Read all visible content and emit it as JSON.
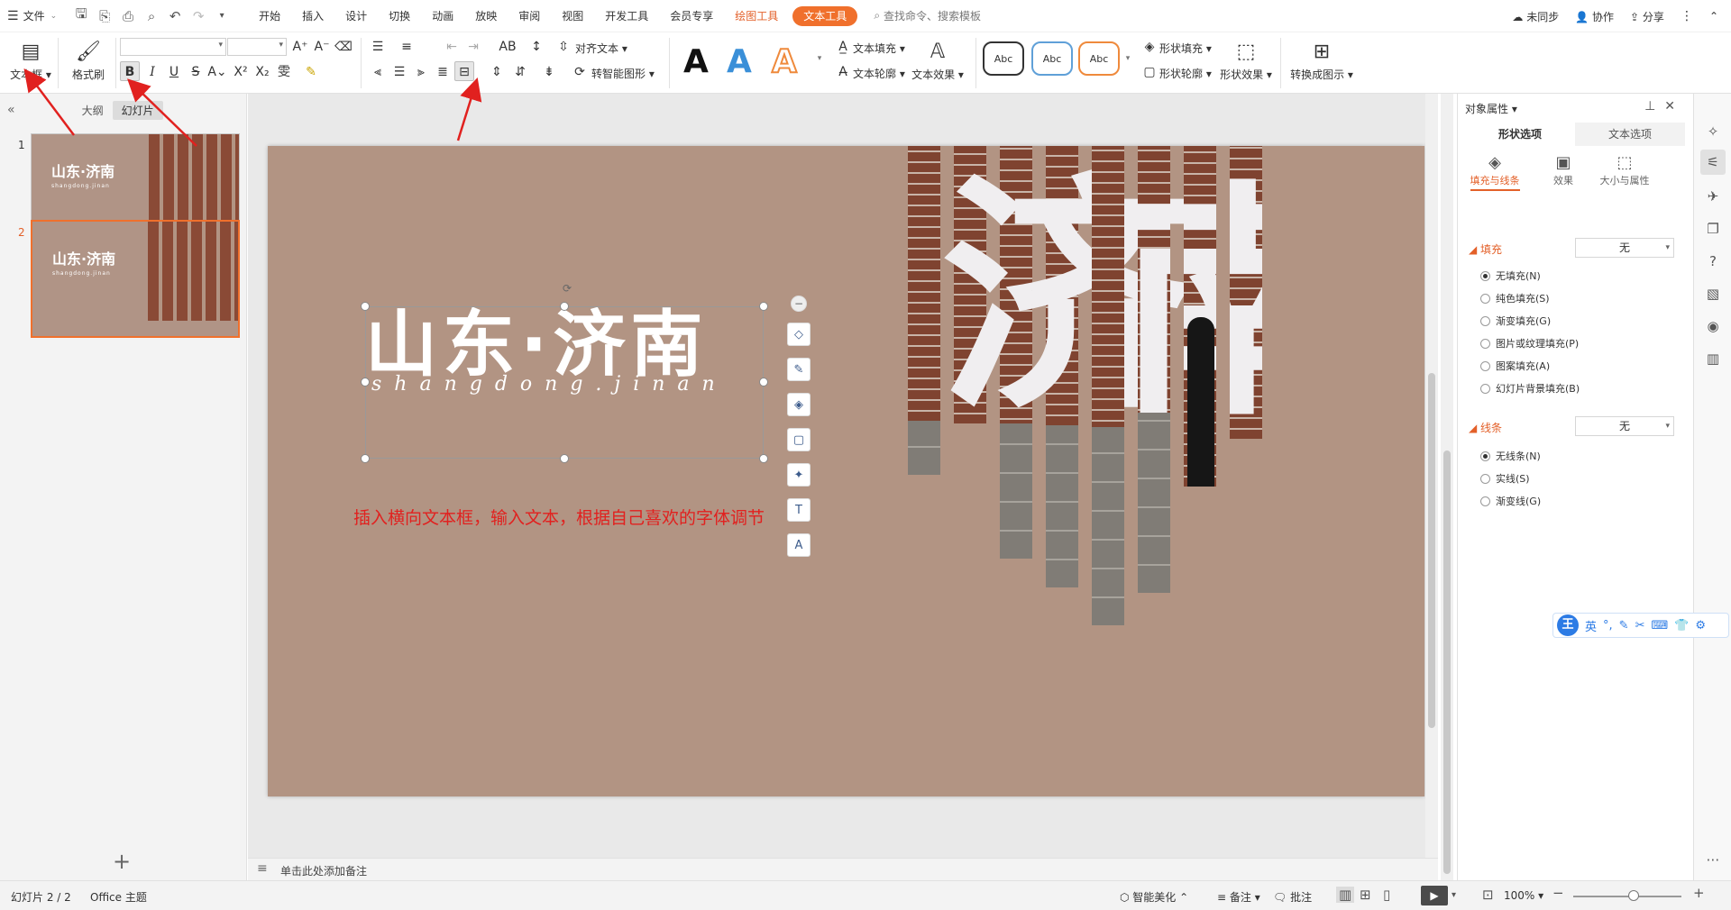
{
  "menubar": {
    "file": "文件",
    "tabs": [
      "开始",
      "插入",
      "设计",
      "切换",
      "动画",
      "放映",
      "审阅",
      "视图",
      "开发工具",
      "会员专享",
      "绘图工具",
      "文本工具"
    ],
    "search": "查找命令、搜索模板",
    "unsynced": "未同步",
    "collab": "协作",
    "share": "分享"
  },
  "ribbon": {
    "textbox": "文本框",
    "formatpainter": "格式刷",
    "align_text": "对齐文本",
    "smart_shape": "转智能图形",
    "wordart_letter": "A",
    "text_fill": "文本填充",
    "text_outline": "文本轮廓",
    "text_effect": "文本效果",
    "shape_styles": [
      "Abc",
      "Abc",
      "Abc"
    ],
    "shape_fill": "形状填充",
    "shape_outline": "形状轮廓",
    "shape_effect": "形状效果",
    "convert_diagram": "转换成图示"
  },
  "leftpanel": {
    "tab_outline": "大纲",
    "tab_slides": "幻灯片",
    "slides": [
      {
        "no": "1",
        "title": "山东·济南",
        "sub": "shangdong.jinan"
      },
      {
        "no": "2",
        "title": "山东·济南",
        "sub": "shangdong.jinan"
      }
    ],
    "add": "+"
  },
  "slide": {
    "title": "山东·济南",
    "subtitle": "shangdong.jinan",
    "note": "插入横向文本框，输入文本，根据自己喜欢的字体调节",
    "photo_text_left": "济",
    "photo_text_right": "南",
    "bg_color": "#b29483"
  },
  "notes": {
    "placeholder": "单击此处添加备注"
  },
  "rightpanel": {
    "title": "对象属性",
    "tabs": [
      "形状选项",
      "文本选项"
    ],
    "subtabs": [
      "填充与线条",
      "效果",
      "大小与属性"
    ],
    "fill_label": "填充",
    "fill_value": "无",
    "fill_options": [
      "无填充(N)",
      "纯色填充(S)",
      "渐变填充(G)",
      "图片或纹理填充(P)",
      "图案填充(A)",
      "幻灯片背景填充(B)"
    ],
    "line_label": "线条",
    "line_value": "无",
    "line_options": [
      "无线条(N)",
      "实线(S)",
      "渐变线(G)"
    ]
  },
  "ime": {
    "logo": "王",
    "mode": "英"
  },
  "statusbar": {
    "slide_count": "幻灯片 2 / 2",
    "theme": "Office 主题",
    "beautify": "智能美化",
    "notes": "备注",
    "comments": "批注",
    "zoom": "100%",
    "zoom_level": 1.0
  },
  "colors": {
    "accent": "#f0702c",
    "annotation": "#e1211f"
  }
}
